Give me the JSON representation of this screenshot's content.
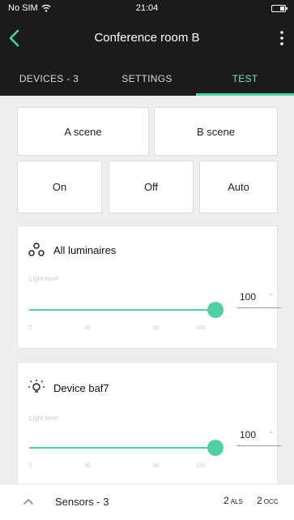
{
  "status_bar": {
    "carrier": "No SIM",
    "time": "21:04"
  },
  "app_bar": {
    "title": "Conference room B"
  },
  "tabs": [
    {
      "label": "DEVICES - 3",
      "active": false
    },
    {
      "label": "SETTINGS",
      "active": false
    },
    {
      "label": "TEST",
      "active": true
    }
  ],
  "scenes": {
    "a_label": "A scene",
    "b_label": "B scene"
  },
  "modes": {
    "on_label": "On",
    "off_label": "Off",
    "auto_label": "Auto"
  },
  "cards": [
    {
      "icon": "luminaires-group-icon",
      "title": "All luminaires",
      "slider_label": "Light level",
      "value": "100",
      "level_percent": 100,
      "ticks": [
        "0",
        "30",
        "60",
        "100"
      ]
    },
    {
      "icon": "lightbulb-icon",
      "title": "Device baf7",
      "slider_label": "Light level",
      "value": "100",
      "level_percent": 100,
      "ticks": [
        "0",
        "30",
        "60",
        "100"
      ]
    }
  ],
  "bottom_bar": {
    "label": "Sensors - 3",
    "als_count": "2",
    "als_unit": "ALS",
    "occ_count": "2",
    "occ_unit": "OCC"
  },
  "colors": {
    "accent": "#4fd1a5",
    "header_bg": "#1b1b1b",
    "page_bg": "#eeeeee"
  }
}
